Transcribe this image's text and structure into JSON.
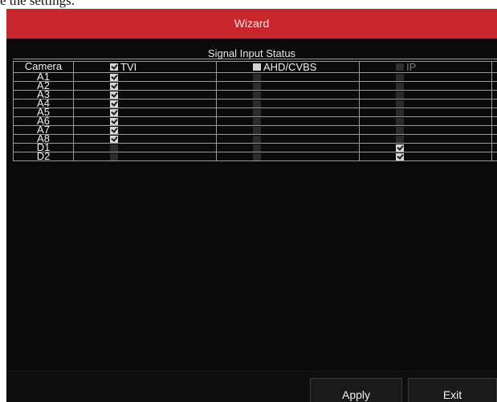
{
  "top_caption": "e the settings.",
  "window": {
    "title": "Wizard"
  },
  "panel": {
    "title": "Signal Input Status",
    "columns": {
      "camera": "Camera",
      "tvi": {
        "label": "TVI",
        "checked": true
      },
      "ahd": {
        "label": "AHD/CVBS",
        "checked": false
      },
      "ip": {
        "label": "IP",
        "checked": false,
        "disabled": true
      }
    },
    "rows": [
      {
        "camera": "A1",
        "tvi": true,
        "ahd": false,
        "ip": false
      },
      {
        "camera": "A2",
        "tvi": true,
        "ahd": false,
        "ip": false
      },
      {
        "camera": "A3",
        "tvi": true,
        "ahd": false,
        "ip": false
      },
      {
        "camera": "A4",
        "tvi": true,
        "ahd": false,
        "ip": false
      },
      {
        "camera": "A5",
        "tvi": true,
        "ahd": false,
        "ip": false
      },
      {
        "camera": "A6",
        "tvi": true,
        "ahd": false,
        "ip": false
      },
      {
        "camera": "A7",
        "tvi": true,
        "ahd": false,
        "ip": false
      },
      {
        "camera": "A8",
        "tvi": true,
        "ahd": false,
        "ip": false
      },
      {
        "camera": "D1",
        "tvi": false,
        "ahd": false,
        "ip": true
      },
      {
        "camera": "D2",
        "tvi": false,
        "ahd": false,
        "ip": true
      }
    ]
  },
  "buttons": {
    "apply": "Apply",
    "exit": "Exit"
  },
  "colors": {
    "title_bar": "#c8262b",
    "background": "#0b0b0b",
    "grid_line": "#9a9a9a"
  }
}
